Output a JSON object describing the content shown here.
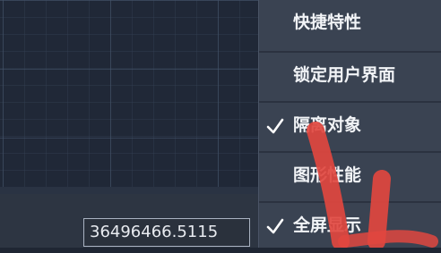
{
  "status_bar": {
    "coordinate_readout": "36496466.5115"
  },
  "context_menu": {
    "items": [
      {
        "label": "快捷特性",
        "checked": false
      },
      {
        "label": "锁定用户界面",
        "checked": false
      },
      {
        "label": "隔离对象",
        "checked": true
      },
      {
        "label": "图形性能",
        "checked": false
      },
      {
        "label": "全屏显示",
        "checked": true
      }
    ]
  },
  "colors": {
    "menu_background": "#3a4352",
    "drawing_background": "#202837",
    "annotation_arrow": "#e1463f"
  },
  "icons": {
    "check": "checkmark-icon",
    "annotation": "red-arrow-annotation"
  }
}
